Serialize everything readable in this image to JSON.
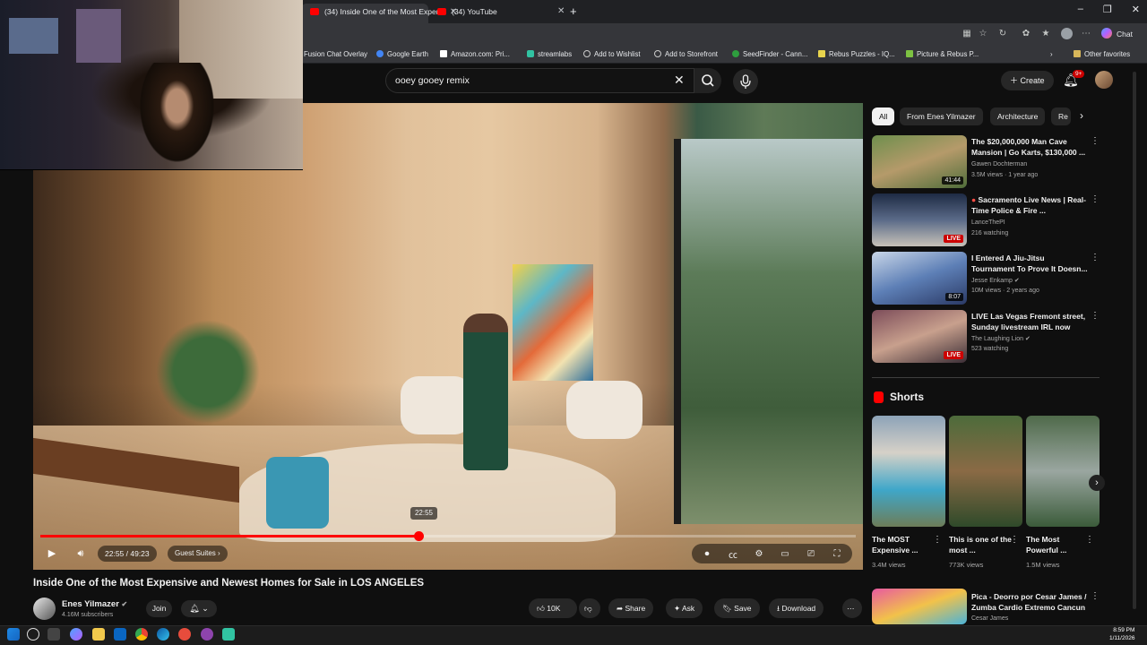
{
  "browser": {
    "tabs": [
      {
        "label": "(34) Inside One of the Most Expen",
        "active": true
      },
      {
        "label": "(34) YouTube",
        "active": false
      }
    ],
    "new_tab": "+",
    "chat_button": "Chat",
    "bookmarks": [
      "Fusion Chat Overlay",
      "Google Earth",
      "Amazon.com: Pri...",
      "streamlabs",
      "Add to Wishlist",
      "Add to Storefront",
      "SeedFinder - Cann...",
      "Rebus Puzzles - IQ...",
      "Picture & Rebus P..."
    ],
    "other_favorites": "Other favorites"
  },
  "header": {
    "search_value": "ooey gooey remix",
    "create_label": "Create",
    "notification_badge": "9+"
  },
  "player": {
    "time": "22:55 / 49:23",
    "chapter": "Guest Suites",
    "scrub_time": "22:55",
    "progress": 0.464
  },
  "video": {
    "title": "Inside One of the Most Expensive and Newest Homes for Sale in LOS ANGELES",
    "channel": "Enes Yilmazer",
    "subscribers": "4.16M subscribers",
    "join_label": "Join",
    "likes": "10K",
    "share_label": "Share",
    "ask_label": "Ask",
    "save_label": "Save",
    "download_label": "Download"
  },
  "sidebar": {
    "chips": [
      "All",
      "From Enes Yilmazer",
      "Architecture",
      "Re"
    ],
    "recommendations": [
      {
        "title": "The $20,000,000 Man Cave Mansion | Go Karts, $130,000 ...",
        "channel": "Gawen Dochterman",
        "meta": "3.5M views · 1 year ago",
        "badge": "41:44",
        "live": false
      },
      {
        "title": "Sacramento Live News | Real-Time Police & Fire ...",
        "channel": "LanceThePI",
        "meta": "216 watching",
        "badge": "LIVE",
        "live": true
      },
      {
        "title": "I Entered A Jiu-Jitsu Tournament To Prove It Doesn...",
        "channel": "Jesse Enkamp",
        "meta": "10M views · 2 years ago",
        "badge": "8:07",
        "live": false
      },
      {
        "title": "LIVE Las Vegas Fremont street, Sunday livestream IRL now",
        "channel": "The Laughing Lion",
        "meta": "523 watching",
        "badge": "LIVE",
        "live": true
      }
    ],
    "shorts_heading": "Shorts",
    "shorts": [
      {
        "title": "The MOST Expensive ...",
        "views": "3.4M views"
      },
      {
        "title": "This is one of the most ...",
        "views": "773K views"
      },
      {
        "title": "The Most Powerful ...",
        "views": "1.5M views"
      }
    ],
    "bottom_rec": {
      "title": "Pica - Deorro por Cesar James / Zumba Cardio Extremo Cancun",
      "channel": "Cesar James"
    }
  },
  "taskbar": {
    "time": "8:59 PM",
    "date": "1/11/2026"
  }
}
